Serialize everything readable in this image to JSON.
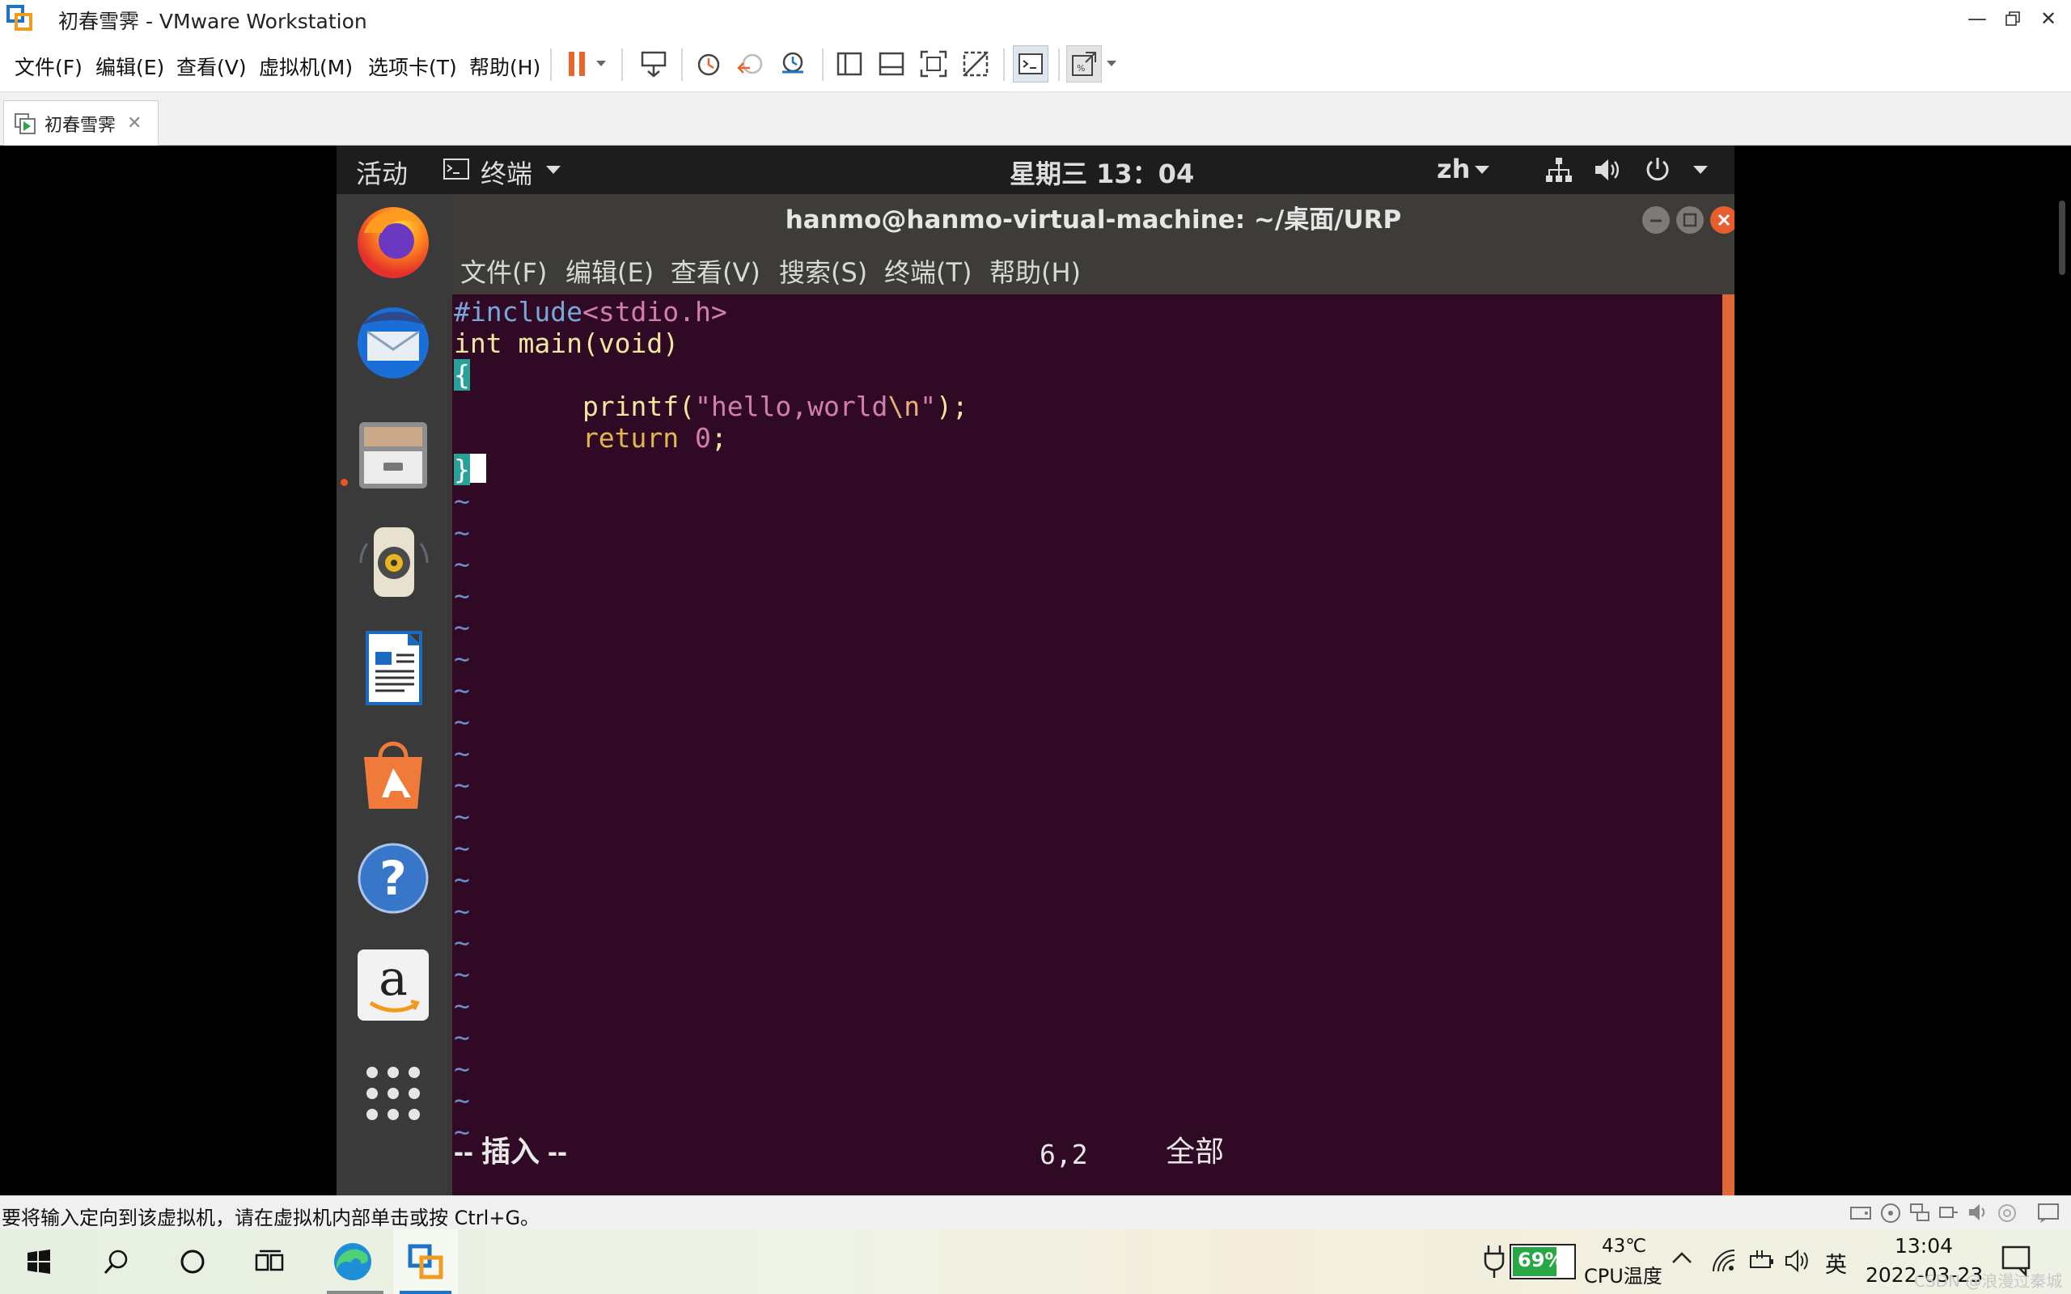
{
  "window": {
    "title": "初春雪霁 - VMware Workstation",
    "minimize_icon": "minimize-icon",
    "maximize_icon": "restore-icon",
    "close_icon": "close-icon"
  },
  "menubar": {
    "items": [
      "文件(F)",
      "编辑(E)",
      "查看(V)",
      "虚拟机(M)",
      "选项卡(T)",
      "帮助(H)"
    ]
  },
  "toolbar": {
    "icons": [
      "pause-icon",
      "dropdown-icon",
      "send-ctrl-alt-del-icon",
      "snapshot-icon",
      "revert-snapshot-icon",
      "snapshot-manager-icon",
      "library-icon",
      "thumbnail-bar-icon",
      "fullscreen-icon",
      "unity-icon",
      "console-view-icon",
      "stretch-guest-icon"
    ],
    "accent": "#e8652c"
  },
  "tab": {
    "label": "初春雪霁",
    "close": "✕"
  },
  "guest": {
    "topbar": {
      "activities": "活动",
      "app": "终端",
      "clock": "星期三 13：04",
      "lang": "zh"
    },
    "dock": [
      "firefox-icon",
      "thunderbird-icon",
      "files-icon",
      "rhythmbox-icon",
      "libreoffice-writer-icon",
      "software-center-icon",
      "help-icon",
      "amazon-icon",
      "show-apps-icon"
    ],
    "terminal": {
      "title": "hanmo@hanmo-virtual-machine: ~/桌面/URP",
      "menu": [
        "文件(F)",
        "编辑(E)",
        "查看(V)",
        "搜索(S)",
        "终端(T)",
        "帮助(H)"
      ],
      "code": {
        "include_kw": "#include",
        "include_path": "<stdio.h>",
        "line2": "int main(void)",
        "brace_open": "{",
        "printf_fn": "        printf(",
        "printf_str_a": "\"hello,world",
        "printf_esc": "\\n",
        "printf_str_b": "\"",
        "printf_end": ");",
        "return_kw": "        return ",
        "return_num": "0",
        "return_end": ";",
        "brace_close": "}"
      },
      "tilde": "~",
      "tilde_rows": 21,
      "mode": "-- 插入 --",
      "position": "6,2",
      "scroll": "全部"
    },
    "colors": {
      "terminal_bg": "#300a24",
      "scrollbar": "#e06836"
    }
  },
  "statusbar": {
    "hint": "要将输入定向到该虚拟机，请在虚拟机内部单击或按 Ctrl+G。"
  },
  "taskbar": {
    "battery": "69%",
    "temp": "43℃",
    "temp_label": "CPU温度",
    "ime": "英",
    "time": "13:04",
    "date": "2022-03-23",
    "watermark": "CSDN @浪漫过秦城"
  }
}
